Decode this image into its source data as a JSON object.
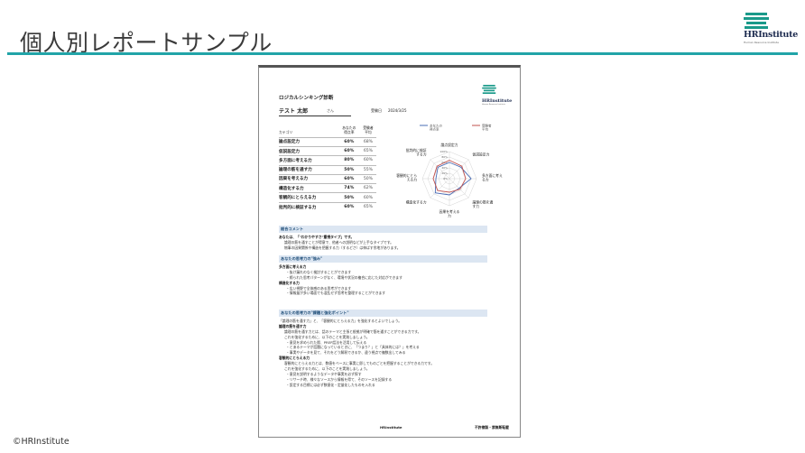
{
  "slide": {
    "title": "個人別レポートサンプル",
    "copyright": "©HRInstitute",
    "logo": {
      "brand": "HRInstitute",
      "sub": "Human Resource Institute"
    },
    "colors": {
      "accent": "#21a4a8",
      "navy": "#1d2b4f"
    }
  },
  "doc": {
    "title": "ロジカルシンキング診断",
    "name": "テスト 太郎",
    "name_suffix": "さん",
    "date_label": "受験日",
    "date_value": "2024/3/25",
    "table": {
      "col_category": "カテゴリ",
      "col_you_1": "あなたの",
      "col_you_2": "得点率",
      "col_avg_1": "受験者",
      "col_avg_2": "平均",
      "rows": [
        {
          "cat": "論点設定力",
          "you": "60%",
          "avg": "68%"
        },
        {
          "cat": "仮説設定力",
          "you": "60%",
          "avg": "65%"
        },
        {
          "cat": "多方面に考える力",
          "you": "80%",
          "avg": "60%"
        },
        {
          "cat": "論理の筋を通す力",
          "you": "50%",
          "avg": "55%"
        },
        {
          "cat": "因果を考える力",
          "you": "60%",
          "avg": "50%"
        },
        {
          "cat": "構造化する力",
          "you": "74%",
          "avg": "62%"
        },
        {
          "cat": "客観的にとらえる力",
          "you": "50%",
          "avg": "60%"
        },
        {
          "cat": "批判的に検証する力",
          "you": "60%",
          "avg": "65%"
        }
      ]
    },
    "chart_data": {
      "type": "radar",
      "axes": [
        "論点設定力",
        "仮説設定力",
        "多方面に考える力",
        "論理の筋を通す力",
        "因果を考える力",
        "構造化する力",
        "客観的にとらえる力",
        "批判的に検証する力"
      ],
      "axis_labels": [
        [
          "論点設定力"
        ],
        [
          "仮説設定力"
        ],
        [
          "多方面に考え",
          "る力"
        ],
        [
          "論理の筋を通",
          "す力"
        ],
        [
          "因果を考える",
          "力"
        ],
        [
          "構造化する力"
        ],
        [
          "客観的にとら",
          "える力"
        ],
        [
          "批判的に検証",
          "する力"
        ]
      ],
      "range": [
        0,
        100
      ],
      "ticks": [
        "100%",
        "80%",
        "60%",
        "40%",
        "20%",
        "0%"
      ],
      "legend": [
        "あなたの得点率",
        "受験者平均"
      ],
      "legend_display": [
        [
          "あなたの",
          "得点率"
        ],
        [
          "受験者",
          "平均"
        ]
      ],
      "series": [
        {
          "name": "あなたの得点率",
          "values": [
            60,
            60,
            80,
            50,
            60,
            74,
            50,
            60
          ],
          "color": "#4a6cb5"
        },
        {
          "name": "受験者平均",
          "values": [
            68,
            65,
            60,
            55,
            50,
            62,
            60,
            65
          ],
          "color": "#c0504d"
        }
      ]
    },
    "sections": [
      {
        "head": "総合コメント",
        "lines": [
          {
            "t": "あなたは、「\"わかりやすさ\"重視タイプ」です。",
            "s": "b"
          },
          {
            "t": "論理の筋を通すことが得意で、他者への説明などが上手なタイプです。",
            "s": "i1"
          },
          {
            "t": "物事の因果関係や構造を把握する力（するどさ）は伸ばす余地があります。",
            "s": "i1"
          }
        ]
      },
      {
        "head": "あなたの思考力の\"強み\"",
        "lines": [
          {
            "t": "多方面に考える力",
            "s": "b"
          },
          {
            "t": "・抜け漏れのなく検討することができます",
            "s": "i2"
          },
          {
            "t": "・締られた思考パターンがなく、環境や状況の複合に応じた対応ができます",
            "s": "i2"
          },
          {
            "t": "構造化する力",
            "s": "b"
          },
          {
            "t": "・広い視野で全体感のある思考ができます",
            "s": "i2"
          },
          {
            "t": "・情報量が多い場面でも混乱せず思考を整理することができます",
            "s": "i2"
          }
        ]
      },
      {
        "head": "あなたの思考力の\"課題と強化ポイント\"",
        "lines": [
          {
            "t": "「論理の筋を通す力」と、「客観的にとらえる力」を強化するとよいでしょう。",
            "s": ""
          },
          {
            "t": "論理の筋を通す力",
            "s": "b"
          },
          {
            "t": "論理の筋を通す力とは、話のテーマと主張と根拠が明確で筋を通すことができる力です。",
            "s": "i1"
          },
          {
            "t": "これを強化するために、以下のことを実践しましょう。",
            "s": "i1"
          },
          {
            "t": "・意見を求められた際、PREP話法を活用して伝える",
            "s": "i2"
          },
          {
            "t": "・とあるテーマが話題になっているときに、「つまり？」と「具体的には？」を考える",
            "s": "i2"
          },
          {
            "t": "・事実やデータを見て、それをどう解釈できるか、違う視点で複数出してみる",
            "s": "i2"
          },
          {
            "t": "客観的にとらえる力",
            "s": "b"
          },
          {
            "t": "客観的にとらえる力とは、数値をベースに事実に即してものごとを把握することができる力です。",
            "s": "i1"
          },
          {
            "t": "これを強化するために、以下のことを実践しましょう。",
            "s": "i1"
          },
          {
            "t": "・意見を説明するようなデータや事実を必ず探す",
            "s": "i2"
          },
          {
            "t": "・リサーチ時、様々なソースから情報を得て、そのソースを記録する",
            "s": "i2"
          },
          {
            "t": "・設定する目標には必ず数値化・定量化したものを入れる",
            "s": "i2"
          }
        ]
      }
    ],
    "footer_left": "HRInstitute",
    "footer_right": "不許複製・禁無断転載"
  }
}
